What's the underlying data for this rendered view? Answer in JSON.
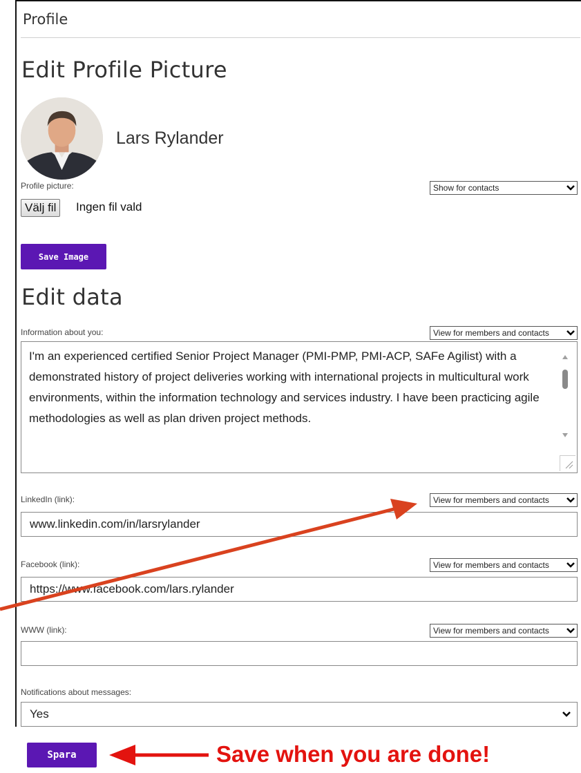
{
  "page": {
    "title": "Profile"
  },
  "profile_picture_section": {
    "heading": "Edit Profile Picture",
    "user_name": "Lars Rylander",
    "picture_label": "Profile picture:",
    "visibility": "Show for contacts",
    "file_button": "Välj fil",
    "file_status": "Ingen fil vald",
    "save_button": "Save Image"
  },
  "edit_data": {
    "heading": "Edit data",
    "about": {
      "label": "Information about you:",
      "visibility": "View for members and contacts",
      "value": "I'm an experienced certified Senior Project Manager (PMI-PMP, PMI-ACP, SAFe Agilist) with a demonstrated history of project deliveries working with international projects in multicultural work environments, within the information technology and services industry. I have been practicing agile methodologies as well as plan driven project methods."
    },
    "linkedin": {
      "label": "LinkedIn (link):",
      "visibility": "View for members and contacts",
      "value": "www.linkedin.com/in/larsrylander"
    },
    "facebook": {
      "label": "Facebook (link):",
      "visibility": "View for members and contacts",
      "value": "https://www.facebook.com/lars.rylander"
    },
    "www": {
      "label": "WWW (link):",
      "visibility": "View for members and contacts",
      "value": ""
    },
    "notifications": {
      "label": "Notifications about messages:",
      "value": "Yes"
    }
  },
  "save_button": "Spara",
  "annotation": {
    "text": "Save when you are done!"
  },
  "colors": {
    "accent": "#5b17b3",
    "annotation": "#e3130f",
    "arrow": "#d9421f"
  },
  "icons": {
    "dropdown": "chevron-down-icon"
  }
}
